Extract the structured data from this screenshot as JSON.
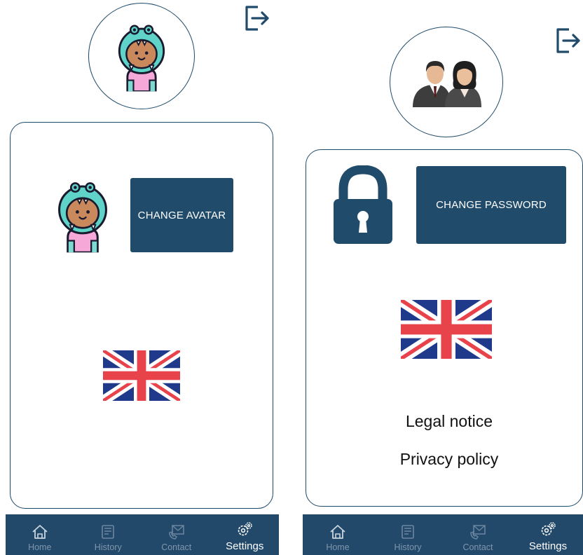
{
  "left_screen": {
    "change_avatar_label": "CHANGE AVATAR",
    "nav": [
      {
        "label": "Home",
        "icon": "home-icon",
        "active": false
      },
      {
        "label": "History",
        "icon": "history-icon",
        "active": false
      },
      {
        "label": "Contact",
        "icon": "contact-icon",
        "active": false
      },
      {
        "label": "Settings",
        "icon": "settings-icon",
        "active": true
      }
    ]
  },
  "right_screen": {
    "change_password_label": "CHANGE PASSWORD",
    "legal_notice": "Legal notice",
    "privacy_policy": "Privacy policy",
    "nav": [
      {
        "label": "Home",
        "icon": "home-icon",
        "active": false
      },
      {
        "label": "History",
        "icon": "history-icon",
        "active": false
      },
      {
        "label": "Contact",
        "icon": "contact-icon",
        "active": false
      },
      {
        "label": "Settings",
        "icon": "settings-icon",
        "active": true
      }
    ]
  },
  "colors": {
    "primary": "#214b6b",
    "nav_background": "#22496a",
    "nav_inactive": "#7f96ac",
    "nav_active": "#ffffff",
    "avatar_teal": "#5fd3c8",
    "flag_blue": "#1f3a8a",
    "flag_red": "#e8434b"
  }
}
